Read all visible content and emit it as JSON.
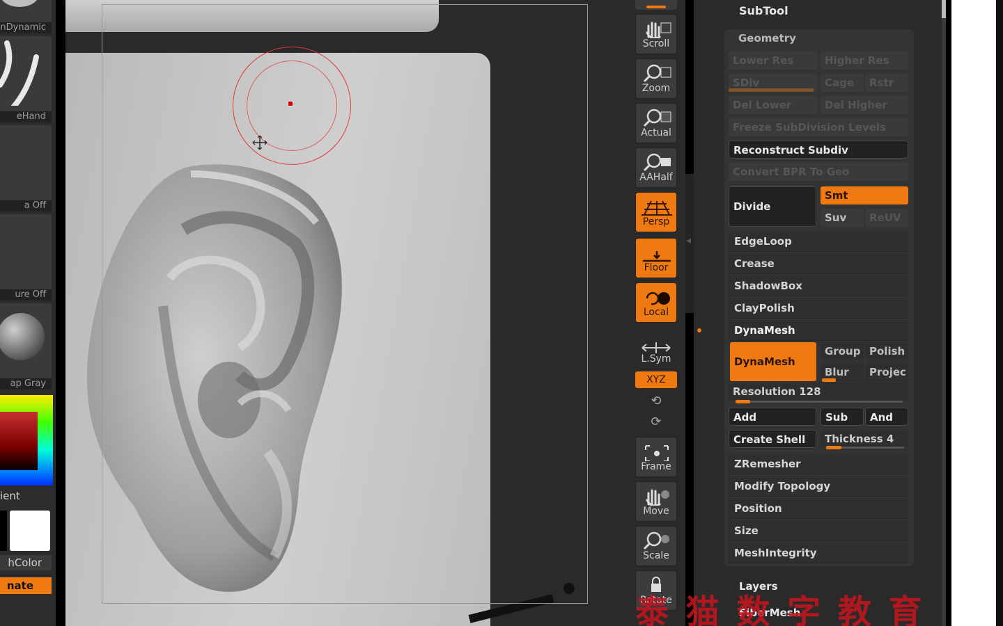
{
  "left_shelf": {
    "thumb_labels": [
      "nDynamic",
      "eHand",
      "a  Off",
      "ure  Off",
      "ap  Gray"
    ],
    "gradient_label": "ient",
    "switch_color_label": "hColor",
    "alternate_label": "nate"
  },
  "canvas": {
    "cursor_icon": "crosshair-move-icon"
  },
  "toolbar": {
    "buttons": [
      {
        "label": "Scroll",
        "icon": "hand-icon",
        "active": false
      },
      {
        "label": "Zoom",
        "icon": "magnifier-icon",
        "active": false
      },
      {
        "label": "Actual",
        "icon": "magnifier-icon",
        "active": false
      },
      {
        "label": "AAHalf",
        "icon": "magnifier-icon",
        "active": false
      },
      {
        "label": "Persp",
        "icon": "perspective-grid-icon",
        "active": true
      },
      {
        "label": "Floor",
        "icon": "floor-grid-icon",
        "active": true
      },
      {
        "label": "Local",
        "icon": "local-pivot-icon",
        "active": true
      },
      {
        "label": "L.Sym",
        "icon": "symmetry-arrows-icon",
        "active": false
      },
      {
        "label": "Frame",
        "icon": "frame-icon",
        "active": false
      },
      {
        "label": "Move",
        "icon": "hand-icon",
        "active": false
      },
      {
        "label": "Scale",
        "icon": "magnifier-icon",
        "active": false
      },
      {
        "label": "Rotate",
        "icon": "rotate-lock-icon",
        "active": false
      }
    ],
    "xyz_label": "XYZ",
    "rot_y_icon": "rotate-y-icon",
    "rot_z_icon": "rotate-z-icon",
    "active_color": "#f07a12"
  },
  "palette": {
    "subtool_title": "SubTool",
    "geometry_title": "Geometry",
    "lower_res": "Lower  Res",
    "higher_res": "Higher  Res",
    "sdiv": "SDiv",
    "cage": "Cage",
    "rstr": "Rstr",
    "del_lower": "Del  Lower",
    "del_higher": "Del  Higher",
    "freeze": "Freeze  SubDivision  Levels",
    "reconstruct": "Reconstruct  Subdiv",
    "convert_bpr": "Convert  BPR  To  Geo",
    "divide": "Divide",
    "smt": "Smt",
    "suv": "Suv",
    "reuv": "ReUV",
    "items_top": [
      "EdgeLoop",
      "Crease",
      "ShadowBox",
      "ClayPolish"
    ],
    "dynamesh_section": "DynaMesh",
    "dynamesh_button": "DynaMesh",
    "group": "Group",
    "polish": "Polish",
    "blur": "Blur",
    "project": "Projec",
    "resolution": "Resolution 128",
    "resolution_value": 128,
    "add": "Add",
    "sub": "Sub",
    "and": "And",
    "create_shell": "Create  Shell",
    "thickness": "Thickness 4",
    "thickness_value": 4,
    "items_bottom": [
      "ZRemesher",
      "Modify  Topology",
      "Position",
      "Size",
      "MeshIntegrity"
    ],
    "layers": "Layers",
    "fibermesh": "FiberMesh"
  },
  "watermark": "泰 猫 数 字 教 育"
}
